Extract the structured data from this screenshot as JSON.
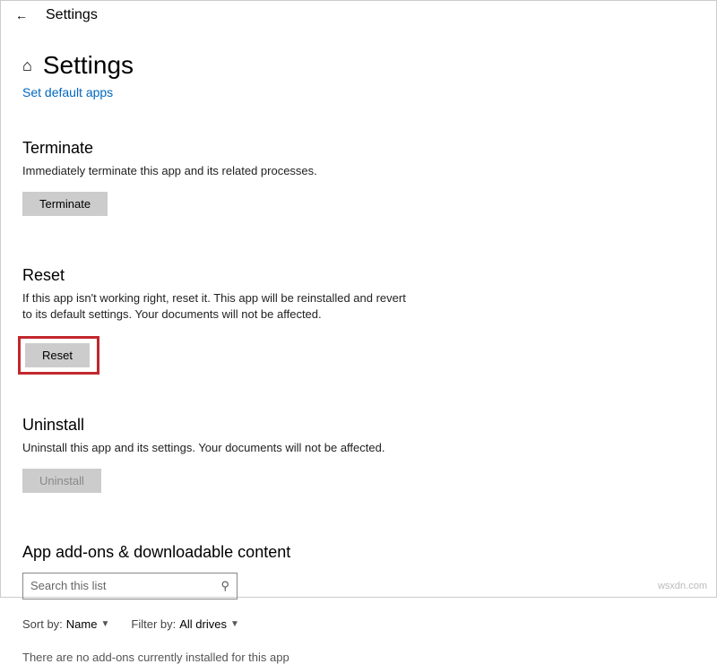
{
  "titlebar": {
    "title": "Settings"
  },
  "header": {
    "page_title": "Settings",
    "set_default_link": "Set default apps"
  },
  "terminate": {
    "heading": "Terminate",
    "desc": "Immediately terminate this app and its related processes.",
    "button": "Terminate"
  },
  "reset": {
    "heading": "Reset",
    "desc": "If this app isn't working right, reset it. This app will be reinstalled and revert to its default settings. Your documents will not be affected.",
    "button": "Reset"
  },
  "uninstall": {
    "heading": "Uninstall",
    "desc": "Uninstall this app and its settings. Your documents will not be affected.",
    "button": "Uninstall"
  },
  "addons": {
    "heading": "App add-ons & downloadable content",
    "search_placeholder": "Search this list",
    "sort_label": "Sort by:",
    "sort_value": "Name",
    "filter_label": "Filter by:",
    "filter_value": "All drives",
    "empty": "There are no add-ons currently installed for this app"
  },
  "watermark": "wsxdn.com"
}
